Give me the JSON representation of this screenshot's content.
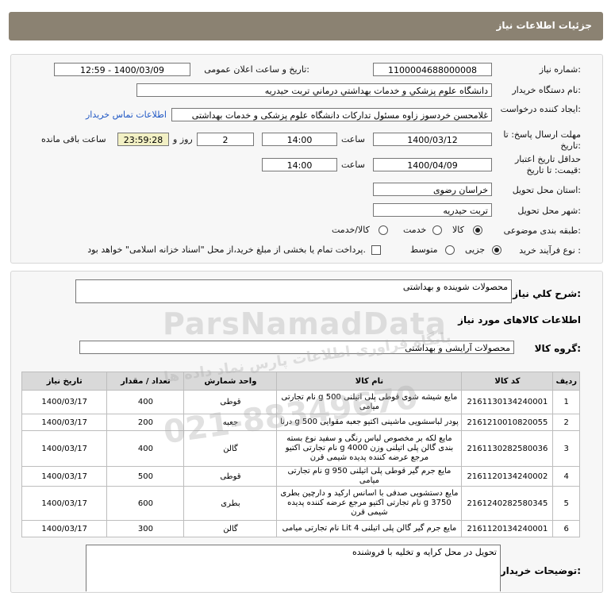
{
  "header": {
    "title": "جزئیات اطلاعات نیاز"
  },
  "form": {
    "need_number_label": "شماره نیاز:",
    "need_number": "1100004688000008",
    "announce_label": "تاریخ و ساعت اعلان عمومی:",
    "announce_value": "1400/03/09 - 12:59",
    "buyer_org_label": "نام دستگاه خریدار:",
    "buyer_org": "دانشگاه علوم پزشکي و خدمات بهداشتي درماني تربت حيدريه",
    "requester_label": "ایجاد کننده درخواست:",
    "requester": "غلامحسن خردسوز زاوه مسئول تدارکات دانشگاه علوم پزشکی و خدمات بهداشتی",
    "contact_link": "اطلاعات تماس خریدار",
    "send_deadline_label": "مهلت ارسال پاسخ: تا تاریخ:",
    "send_date": "1400/03/12",
    "time_label": "ساعت",
    "send_time": "14:00",
    "days_value": "2",
    "days_label": "روز و",
    "remaining_time": "23:59:28",
    "remaining_label": "ساعت باقی مانده",
    "validity_label": "حداقل تاریخ اعتبار قیمت: تا تاریخ:",
    "validity_date": "1400/04/09",
    "validity_time": "14:00",
    "province_label": "استان محل تحویل:",
    "province": "خراسان رضوی",
    "city_label": "شهر محل تحویل:",
    "city": "تربت حیدریه",
    "category_label": "طبقه بندی موضوعی:",
    "category_options": [
      "کالا",
      "خدمت",
      "کالا/خدمت"
    ],
    "purchase_label": "نوع فرآیند خرید :",
    "purchase_options": [
      "جزیی",
      "متوسط"
    ],
    "payment_note": "پرداخت تمام یا بخشی از مبلغ خرید،از محل \"اسناد خزانه اسلامی\" خواهد بود."
  },
  "details": {
    "need_desc_label": "شرح کلي نياز:",
    "need_desc": "محصولات شوینده و بهداشتی",
    "goods_info_label": "اطلاعات کالاهای مورد نیاز",
    "goods_group_label": "گروه کالا:",
    "goods_group": "محصولات آرایشی و بهداشتی"
  },
  "table": {
    "headers": [
      "ردیف",
      "کد کالا",
      "نام کالا",
      "واحد شمارش",
      "تعداد / مقدار",
      "تاریخ نیاز"
    ],
    "rows": [
      {
        "n": "1",
        "code": "2161130134240001",
        "name": "مایع شیشه شوی قوطی پلی اتیلنی 500 g نام تجارتی میامی",
        "unit": "قوطی",
        "qty": "400",
        "date": "1400/03/17"
      },
      {
        "n": "2",
        "code": "2161210010820055",
        "name": "پودر لباسشویی ماشینی اکتیو جعبه مقوایی 500 g درنا",
        "unit": "جعبه",
        "qty": "200",
        "date": "1400/03/17"
      },
      {
        "n": "3",
        "code": "2161130282580036",
        "name": "مایع لکه بر مخصوص لباس رنگی و سفید نوع بسته بندی گالن پلی اتیلنی وزن 4000 g نام تجارتی اکتیو مرجع عرضه کننده پدیده شیمی قرن",
        "unit": "گالن",
        "qty": "400",
        "date": "1400/03/17"
      },
      {
        "n": "4",
        "code": "2161120134240002",
        "name": "مایع جرم گیر قوطی پلی اتیلنی 950 g نام تجارتی میامی",
        "unit": "قوطی",
        "qty": "500",
        "date": "1400/03/17"
      },
      {
        "n": "5",
        "code": "2161240282580345",
        "name": "مایع دستشویی صدفی با اسانس ارکید و دارچین بطری 3750 g نام تجارتی اکتیو مرجع عرضه کننده پدیده شیمی قرن",
        "unit": "بطری",
        "qty": "600",
        "date": "1400/03/17"
      },
      {
        "n": "6",
        "code": "2161120134240001",
        "name": "مایع جرم گیر گالن پلی اتیلنی 4 Lit نام تجارتی میامی",
        "unit": "گالن",
        "qty": "300",
        "date": "1400/03/17"
      }
    ]
  },
  "buyer_notes": {
    "label": "توضیحات خریدار:",
    "text": "تحویل در محل  کرایه  و تخلیه با فروشنده"
  },
  "watermark": {
    "brand": "ParsNamadData",
    "tagline": "پایگاه فراوری اطلاعات پارس نماد داده ها",
    "phone": "021-88349670"
  },
  "colors": {
    "header_bg": "#8b8272",
    "link": "#1f57c4",
    "remaining_bg": "#f2f0c4"
  }
}
